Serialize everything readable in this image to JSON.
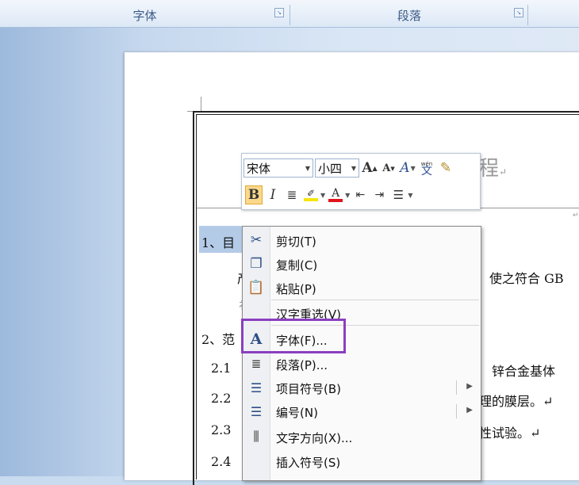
{
  "ribbon": {
    "groups": [
      {
        "label": "字体"
      },
      {
        "label": "段落"
      }
    ]
  },
  "document": {
    "title_fragment": "程",
    "pilcrow": "↵",
    "lines": [
      {
        "text": "1、目"
      },
      {
        "text": "产"
      },
      {
        "text": "2、范"
      },
      {
        "text": "2.1"
      },
      {
        "text": "2.2"
      },
      {
        "text": "2.3"
      },
      {
        "text": "2.4"
      }
    ],
    "right_text": [
      {
        "text": "使之符合 GB"
      },
      {
        "text": "锌合金基体"
      },
      {
        "text": "理的膜层。↵"
      },
      {
        "text": "性试验。↵"
      }
    ]
  },
  "mini_toolbar": {
    "font_name": "宋体",
    "font_size": "小四",
    "bold_label": "B",
    "italic_label": "I",
    "font_color_label": "A",
    "phonetic_label": "wén",
    "phonetic_char": "文",
    "highlight_color": "#f5e50c",
    "font_color": "#e0141b"
  },
  "context_menu": {
    "items": [
      {
        "label": "剪切(T)",
        "icon": "scissors-icon"
      },
      {
        "label": "复制(C)",
        "icon": "copy-icon"
      },
      {
        "label": "粘贴(P)",
        "icon": "paste-icon"
      },
      {
        "label": "汉字重选(V)",
        "icon": ""
      },
      {
        "label": "字体(F)...",
        "icon": "font-icon"
      },
      {
        "label": "段落(P)...",
        "icon": "paragraph-icon"
      },
      {
        "label": "项目符号(B)",
        "icon": "bullets-icon"
      },
      {
        "label": "编号(N)",
        "icon": "numbering-icon"
      },
      {
        "label": "文字方向(X)...",
        "icon": "text-direction-icon"
      },
      {
        "label": "插入符号(S)",
        "icon": ""
      }
    ],
    "highlight_color": "#8a3fbf"
  }
}
